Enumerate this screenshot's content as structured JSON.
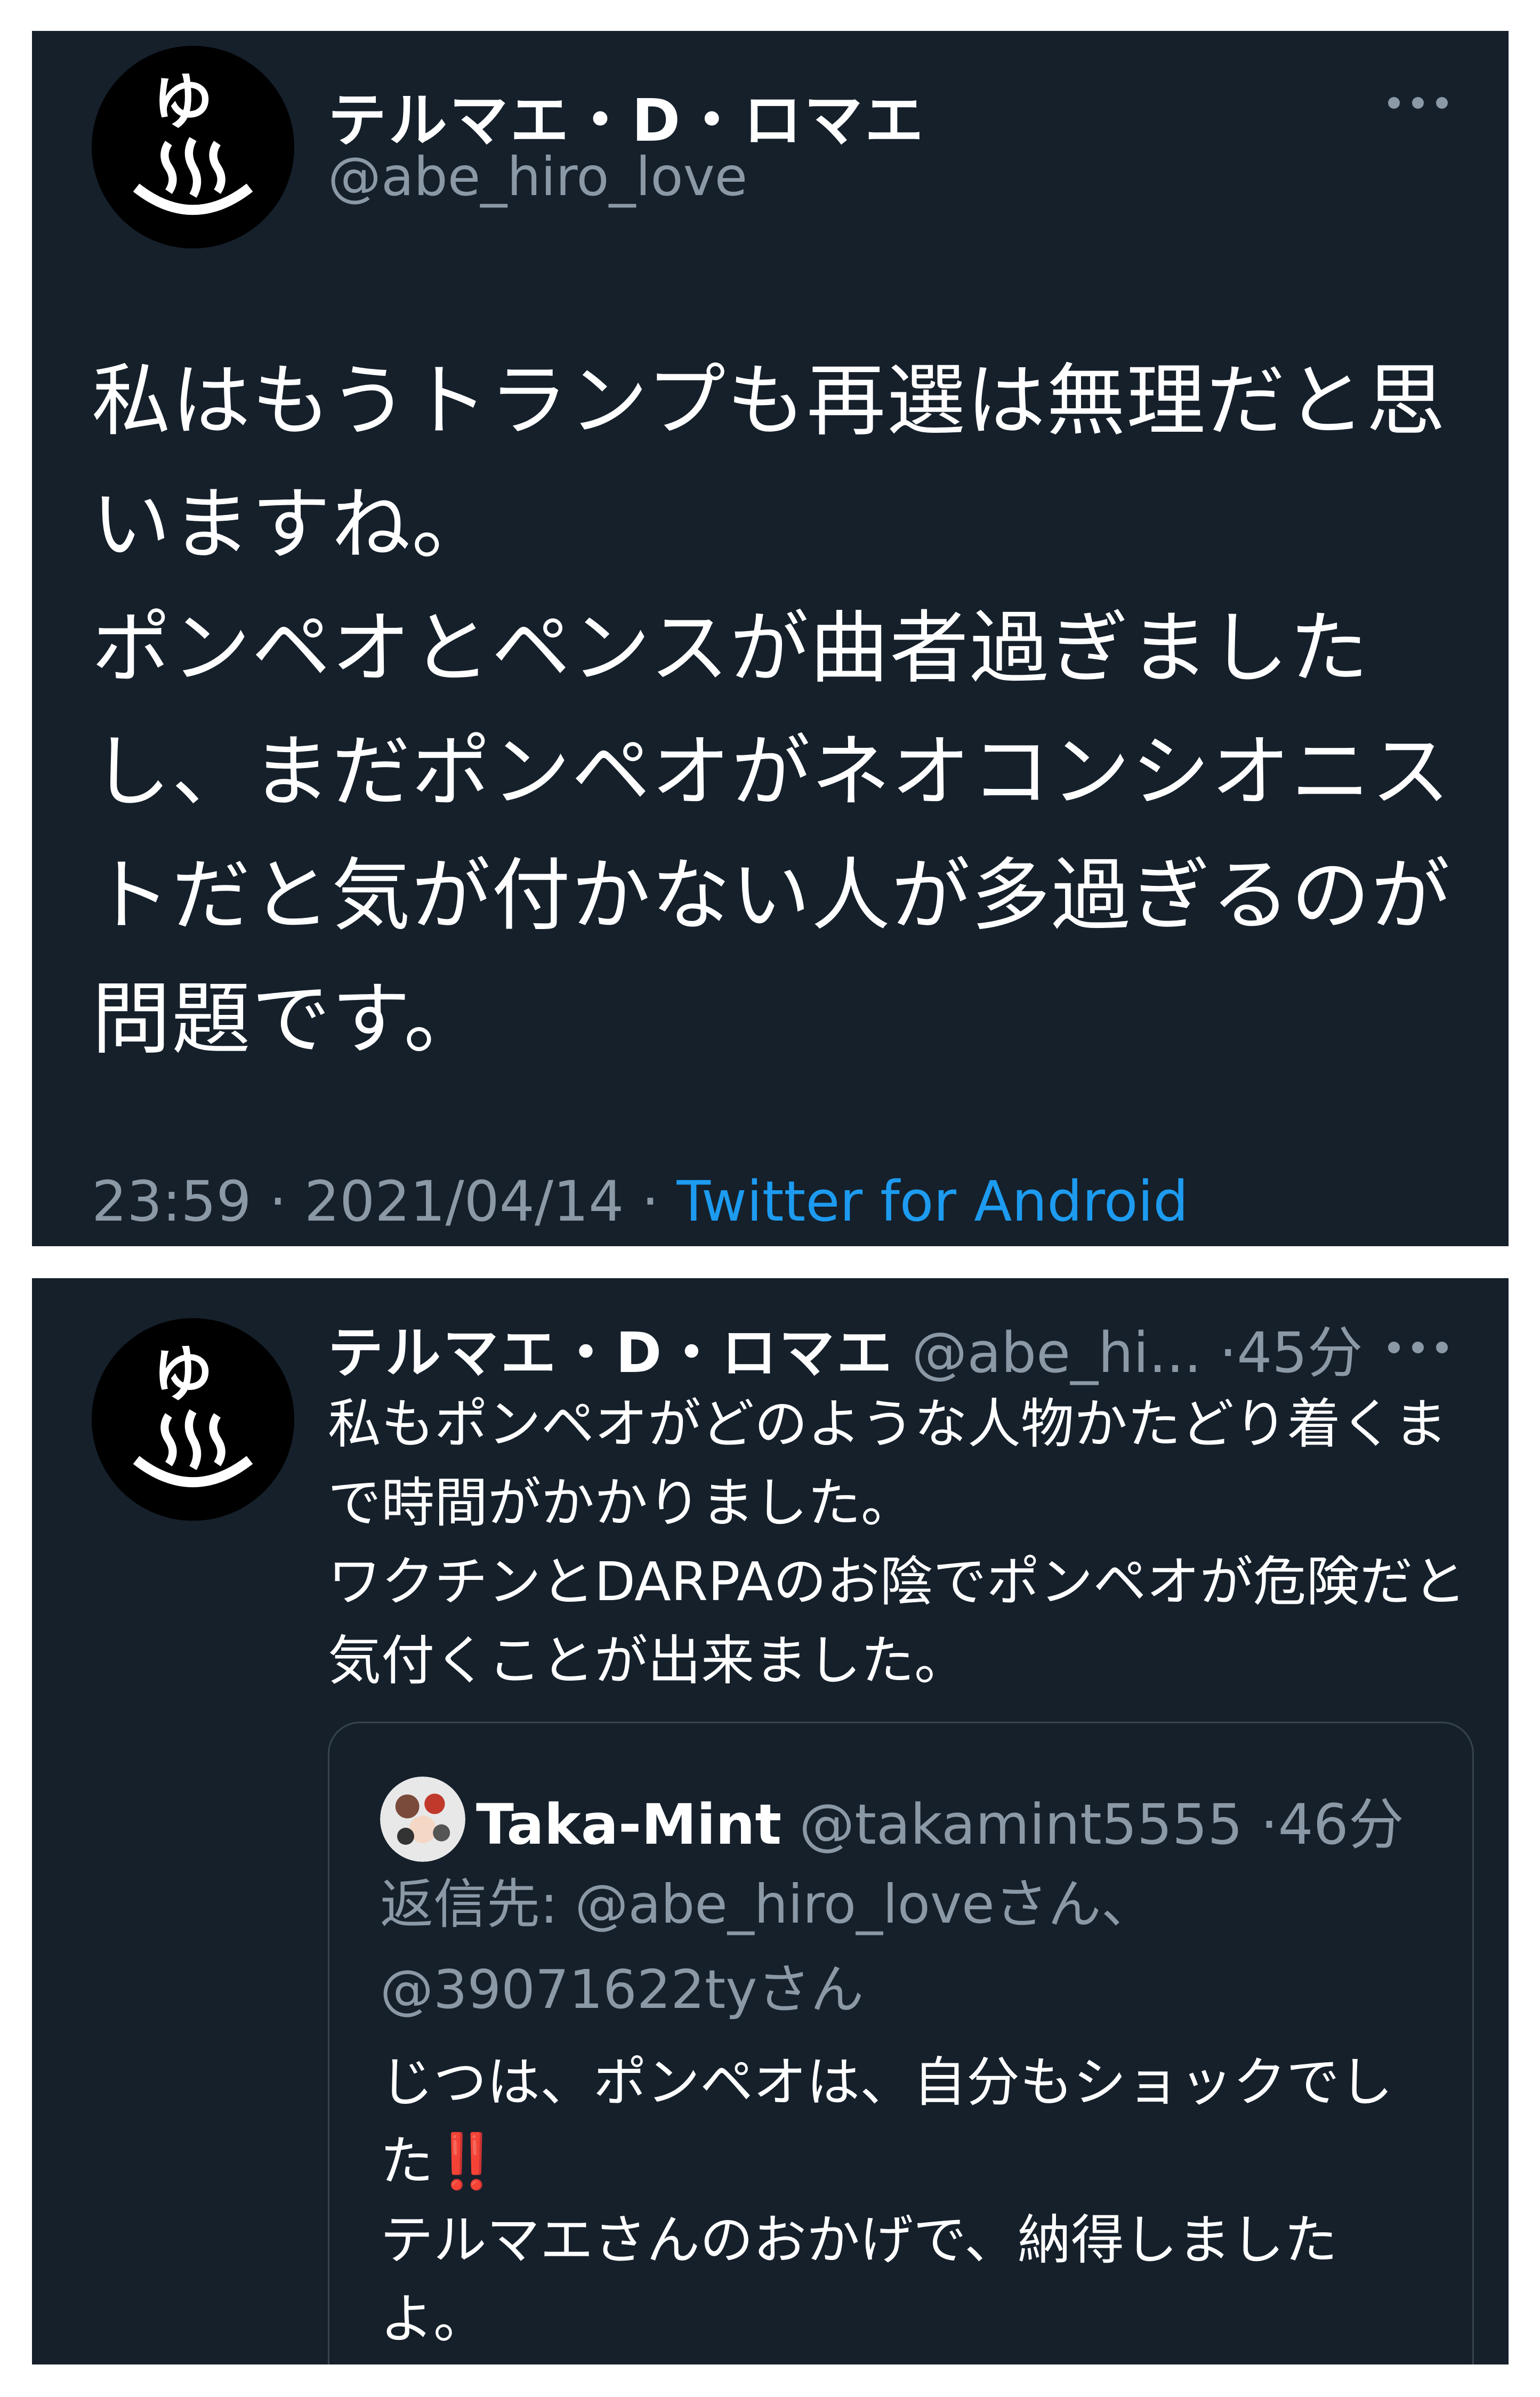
{
  "tweet1": {
    "author_name": "テルマエ・D・ロマエ",
    "author_handle": "@abe_hiro_love",
    "avatar_icon": "onsen-hot-spring-icon",
    "text": "私はもうトランプも再選は無理だと思いますね。\nポンペオとペンスが曲者過ぎましたし、まだポンペオがネオコンシオニストだと気が付かない人が多過ぎるのが問題です。",
    "time": "23:59",
    "date": "2021/04/14",
    "source": "Twitter for Android",
    "separator": "·"
  },
  "tweet2": {
    "author_name": "テルマエ・D・ロマエ",
    "author_handle": "@abe_hi...",
    "time_ago": "45分",
    "separator": "·",
    "text": "私もポンペオがどのような人物かたどり着くまで時間がかかりました。\nワクチンとDARPAのお陰でポンペオが危険だと気付くことが出来ました。",
    "quote": {
      "author_name": "Taka-Mint",
      "author_handle": "@takamint5555",
      "time_ago": "46分",
      "reply_to_label": "返信先: ",
      "reply_to_1": "@abe_hiro_love",
      "reply_to_suffix_1": "さん、",
      "reply_to_2": "@39071622ty",
      "reply_to_suffix_2": "さん",
      "text_part1": "じつは、ポンペオは、自分もショックでした",
      "emoji": "‼️",
      "text_part2": "\nテルマエさんのおかげで、納得しましたよ。"
    }
  },
  "colors": {
    "background": "#15202b",
    "text": "#ffffff",
    "muted": "#8b98a5",
    "link": "#1d9bf0",
    "border": "#38444d",
    "emoji_red": "#e0245e"
  }
}
